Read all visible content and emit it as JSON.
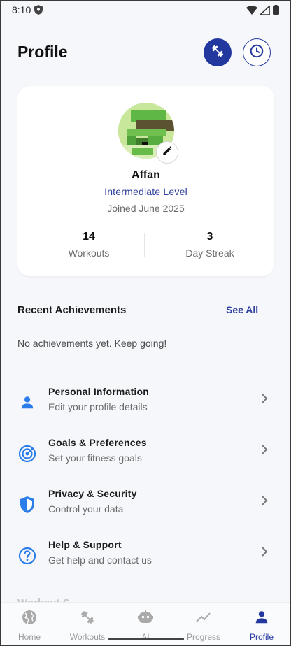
{
  "status_bar": {
    "time": "8:10"
  },
  "header": {
    "title": "Profile"
  },
  "profile": {
    "name": "Affan",
    "level": "Intermediate Level",
    "joined": "Joined June 2025",
    "stats": [
      {
        "value": "14",
        "label": "Workouts"
      },
      {
        "value": "3",
        "label": "Day Streak"
      }
    ]
  },
  "achievements": {
    "title": "Recent Achievements",
    "see_all": "See All",
    "empty_text": "No achievements yet. Keep going!"
  },
  "menu": [
    {
      "icon": "person-icon",
      "title": "Personal Information",
      "subtitle": "Edit your profile details"
    },
    {
      "icon": "target-icon",
      "title": "Goals & Preferences",
      "subtitle": "Set your fitness goals"
    },
    {
      "icon": "shield-icon",
      "title": "Privacy & Security",
      "subtitle": "Control your data"
    },
    {
      "icon": "help-icon",
      "title": "Help & Support",
      "subtitle": "Get help and contact us"
    }
  ],
  "next_section_partial": "Workout S",
  "bottom_nav": [
    {
      "label": "Home",
      "icon": "globe-icon",
      "active": false
    },
    {
      "label": "Workouts",
      "icon": "dumbbell-icon",
      "active": false
    },
    {
      "label": "AI",
      "icon": "robot-icon",
      "active": false
    },
    {
      "label": "Progress",
      "icon": "trending-icon",
      "active": false
    },
    {
      "label": "Profile",
      "icon": "person-icon",
      "active": true
    }
  ],
  "colors": {
    "accent": "#23389e",
    "menu_icon": "#2b7de9",
    "background": "#f6f7fb",
    "card": "#ffffff"
  }
}
